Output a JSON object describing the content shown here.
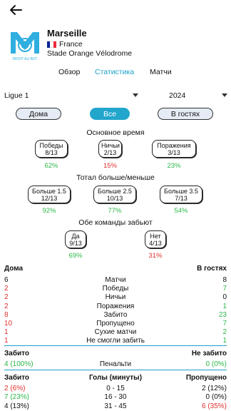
{
  "header": {
    "back_icon": "arrow-left-icon",
    "team": "Marseille",
    "country": "France",
    "flag_colors": [
      "#002395",
      "#ffffff",
      "#ed2939"
    ],
    "stadium": "Stade Orange Vélodrome",
    "logo_text": "DROIT AU BUT",
    "brand_color": "#2faee0"
  },
  "tabs": [
    {
      "label": "Обзор",
      "active": false
    },
    {
      "label": "Статистика",
      "active": true
    },
    {
      "label": "Матчи",
      "active": false
    }
  ],
  "filters": {
    "league": "Ligue 1",
    "season": "2024"
  },
  "venue_pills": [
    {
      "label": "Дома",
      "active": false
    },
    {
      "label": "Все",
      "active": true
    },
    {
      "label": "В гостях",
      "active": false
    }
  ],
  "main_time": {
    "title": "Основное время",
    "items": [
      {
        "label": "Победы",
        "value": "8/13",
        "pct": "62%",
        "color": "green"
      },
      {
        "label": "Ничьи",
        "value": "2/13",
        "pct": "15%",
        "color": "red"
      },
      {
        "label": "Поражения",
        "value": "3/13",
        "pct": "23%",
        "color": "green"
      }
    ]
  },
  "total": {
    "title": "Тотал больше/меньше",
    "items": [
      {
        "label": "Больше 1.5",
        "value": "12/13",
        "pct": "92%",
        "color": "green"
      },
      {
        "label": "Больше 2.5",
        "value": "10/13",
        "pct": "77%",
        "color": "green"
      },
      {
        "label": "Больше 3.5",
        "value": "7/13",
        "pct": "54%",
        "color": "green"
      }
    ]
  },
  "btts": {
    "title": "Обе команды забьют",
    "items": [
      {
        "label": "Да",
        "value": "9/13",
        "pct": "69%",
        "color": "green"
      },
      {
        "label": "Нет",
        "value": "4/13",
        "pct": "31%",
        "color": "red"
      }
    ]
  },
  "home_away": {
    "left_header": "Дома",
    "right_header": "В гостях",
    "rows": [
      {
        "home": "6",
        "label": "Матчи",
        "away": "8",
        "hc": "",
        "ac": ""
      },
      {
        "home": "2",
        "label": "Победы",
        "away": "7",
        "hc": "red",
        "ac": "green"
      },
      {
        "home": "2",
        "label": "Ничьи",
        "away": "0",
        "hc": "red",
        "ac": ""
      },
      {
        "home": "2",
        "label": "Поражения",
        "away": "1",
        "hc": "red",
        "ac": "green"
      },
      {
        "home": "8",
        "label": "Забито",
        "away": "23",
        "hc": "red",
        "ac": "green"
      },
      {
        "home": "10",
        "label": "Пропущено",
        "away": "7",
        "hc": "red",
        "ac": "green"
      },
      {
        "home": "1",
        "label": "Сухие матчи",
        "away": "2",
        "hc": "red",
        "ac": "green"
      },
      {
        "home": "1",
        "label": "Не смогли забить",
        "away": "1",
        "hc": "red",
        "ac": "green"
      }
    ]
  },
  "penalties": {
    "left_header": "Забито",
    "right_header": "Не забито",
    "scored": "4 (100%)",
    "label": "Пенальти",
    "missed": "0 (0%)"
  },
  "goals_by_minute": {
    "left_header": "Забито",
    "center_header": "Голы (минуты)",
    "right_header": "Пропущено",
    "rows": [
      {
        "scored": "2 (6%)",
        "range": "0 - 15",
        "conceded": "2 (12%)",
        "sc": "red",
        "cc": ""
      },
      {
        "scored": "7 (23%)",
        "range": "16 - 30",
        "conceded": "0 (0%)",
        "sc": "green",
        "cc": ""
      },
      {
        "scored": "4 (13%)",
        "range": "31 - 45",
        "conceded": "6 (35%)",
        "sc": "",
        "cc": "red"
      }
    ]
  }
}
